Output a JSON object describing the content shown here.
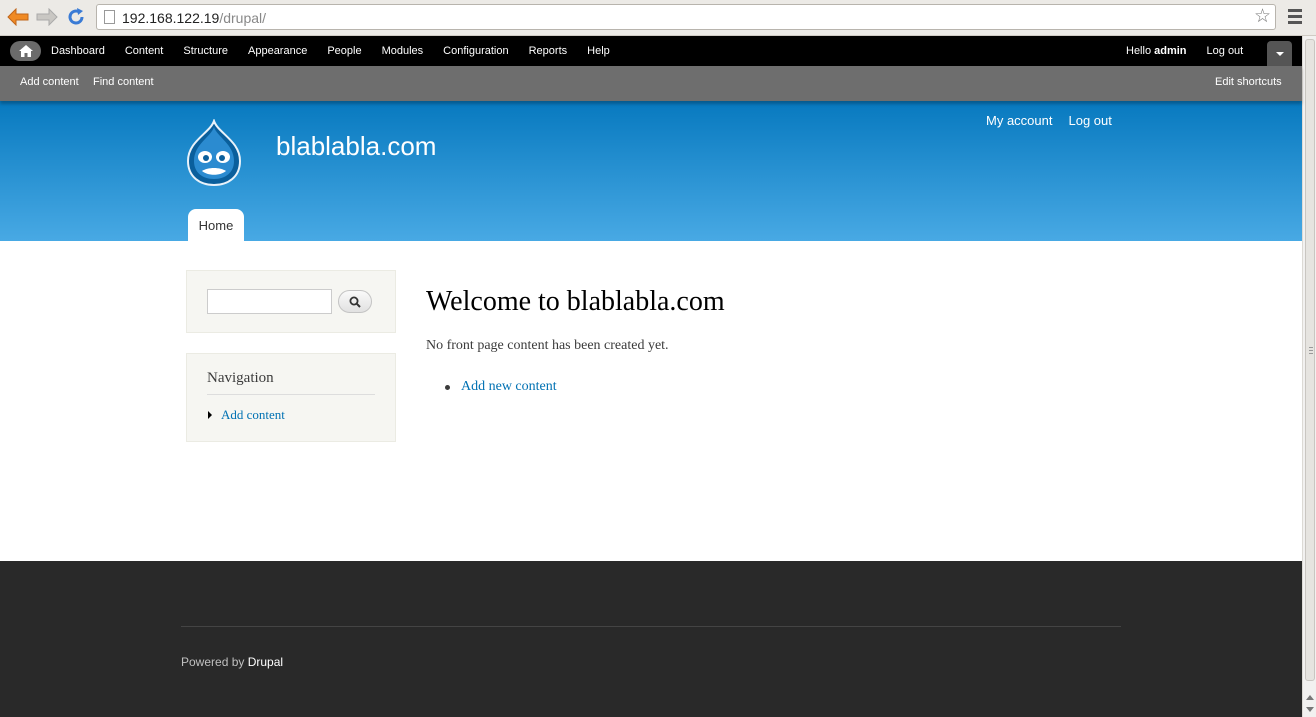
{
  "browser": {
    "url_host": "192.168.122.19",
    "url_path": "/drupal/"
  },
  "toolbar": {
    "menu": [
      {
        "label": "Dashboard"
      },
      {
        "label": "Content"
      },
      {
        "label": "Structure"
      },
      {
        "label": "Appearance"
      },
      {
        "label": "People"
      },
      {
        "label": "Modules"
      },
      {
        "label": "Configuration"
      },
      {
        "label": "Reports"
      },
      {
        "label": "Help"
      }
    ],
    "hello": "Hello ",
    "username": "admin",
    "logout": "Log out"
  },
  "shortcuts": {
    "add_content": "Add content",
    "find_content": "Find content",
    "edit_shortcuts": "Edit shortcuts"
  },
  "header": {
    "site_name": "blablabla.com",
    "my_account": "My account",
    "log_out": "Log out",
    "home_tab": "Home"
  },
  "sidebar": {
    "search_value": "",
    "navigation_title": "Navigation",
    "navigation_items": [
      {
        "label": "Add content"
      }
    ]
  },
  "main": {
    "title": "Welcome to blablabla.com",
    "intro": "No front page content has been created yet.",
    "links": [
      {
        "label": "Add new content"
      }
    ]
  },
  "footer": {
    "powered_by": "Powered by ",
    "drupal_link": "Drupal"
  },
  "colors": {
    "header_top": "#0779bf",
    "header_bottom": "#48a9e4",
    "link": "#0071b3",
    "footer_bg": "#292929"
  }
}
